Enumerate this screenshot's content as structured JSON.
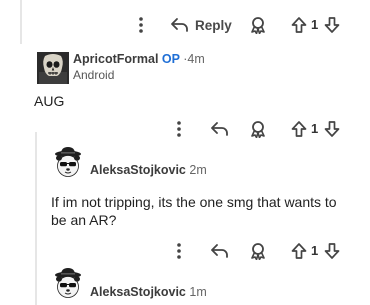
{
  "top_action_bar": {
    "reply_label": "Reply",
    "vote_count": "1"
  },
  "comment_op": {
    "username": "ApricotFormal",
    "op_tag": "OP",
    "separator": "·",
    "age": "4m",
    "platform": "Android",
    "body": "AUG",
    "vote_count": "1"
  },
  "comment_aleksa_1": {
    "username": "AleksaStojkovic",
    "age": "2m",
    "body": "If im not tripping, its the one smg that wants to be an AR?",
    "vote_count": "1"
  },
  "comment_aleksa_2": {
    "username": "AleksaStojkovic",
    "age": "1m"
  },
  "icons": {
    "more": "more-vertical-icon",
    "reply": "reply-arrow-icon",
    "award": "award-icon",
    "upvote": "upvote-arrow-icon",
    "downvote": "downvote-arrow-icon"
  }
}
